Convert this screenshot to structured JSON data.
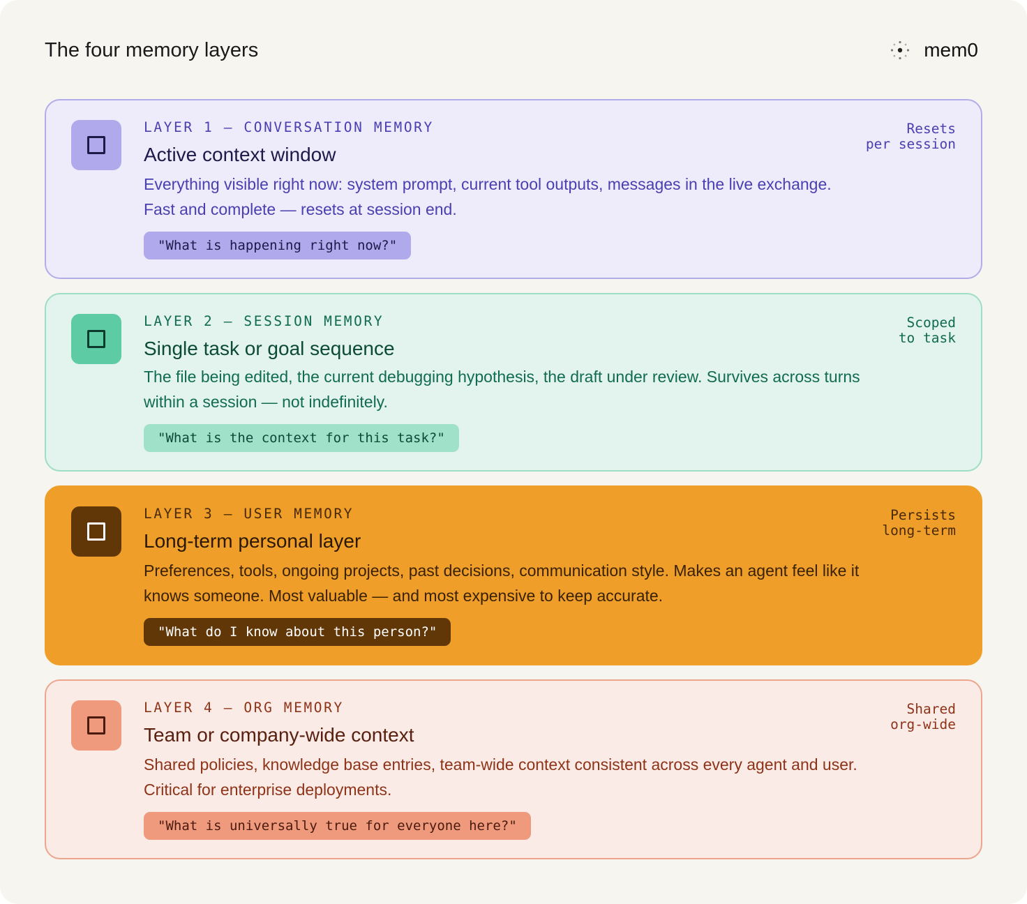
{
  "header": {
    "title": "The four memory layers",
    "brand_name": "mem0",
    "brand_icon": "mem0-logo-icon"
  },
  "layers": [
    {
      "label": "LAYER 1 — CONVERSATION MEMORY",
      "title": "Active context window",
      "description": "Everything visible right now: system prompt, current tool outputs, messages in the live exchange. Fast and complete — resets at session end.",
      "question": "\"What is happening right now?\"",
      "retention_line1": "Resets",
      "retention_line2": "per session",
      "accent": "#b0a9ec",
      "icon": "square-icon"
    },
    {
      "label": "LAYER 2 — SESSION MEMORY",
      "title": "Single task or goal sequence",
      "description": "The file being edited, the current debugging hypothesis, the draft under review. Survives across turns within a session — not indefinitely.",
      "question": "\"What is the context for this task?\"",
      "retention_line1": "Scoped",
      "retention_line2": "to task",
      "accent": "#5dcba4",
      "icon": "square-icon"
    },
    {
      "label": "LAYER 3 — USER MEMORY",
      "title": "Long-term personal layer",
      "description": "Preferences, tools, ongoing projects, past decisions, communication style. Makes an agent feel like it knows someone. Most valuable — and most expensive to keep accurate.",
      "question": "\"What do I know about this person?\"",
      "retention_line1": "Persists",
      "retention_line2": "long-term",
      "accent": "#ef9f29",
      "icon": "square-icon"
    },
    {
      "label": "LAYER 4 — ORG MEMORY",
      "title": "Team or company-wide context",
      "description": "Shared policies, knowledge base entries, team-wide context consistent across every agent and user. Critical for enterprise deployments.",
      "question": "\"What is universally true for everyone here?\"",
      "retention_line1": "Shared",
      "retention_line2": "org-wide",
      "accent": "#ef9a7c",
      "icon": "square-icon"
    }
  ]
}
